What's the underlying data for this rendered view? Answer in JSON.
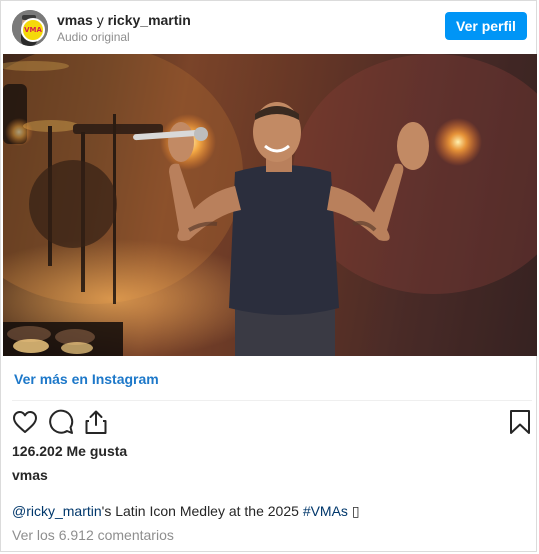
{
  "header": {
    "user_primary": "vmas",
    "connector": " y ",
    "user_secondary": "ricky_martin",
    "audio": "Audio original",
    "avatar_badge": "VMA",
    "profile_button": "Ver perfil"
  },
  "media": {
    "description_icon": "video-thumbnail"
  },
  "see_more_link": "Ver más en Instagram",
  "actions": {
    "like_icon": "heart-icon",
    "comment_icon": "comment-bubble-icon",
    "share_icon": "share-upload-icon",
    "save_icon": "bookmark-icon"
  },
  "likes": "126.202 Me gusta",
  "owner": "vmas",
  "caption": {
    "mention": "@ricky_martin",
    "text": "'s Latin Icon Medley at the 2025 ",
    "hashtag": "#VMAs",
    "tail": " ▯"
  },
  "comments_link": "Ver los 6.912 comentarios",
  "colors": {
    "accent": "#0095f6",
    "link": "#1d78c9",
    "text": "#262626",
    "muted": "#8e8e8e"
  }
}
